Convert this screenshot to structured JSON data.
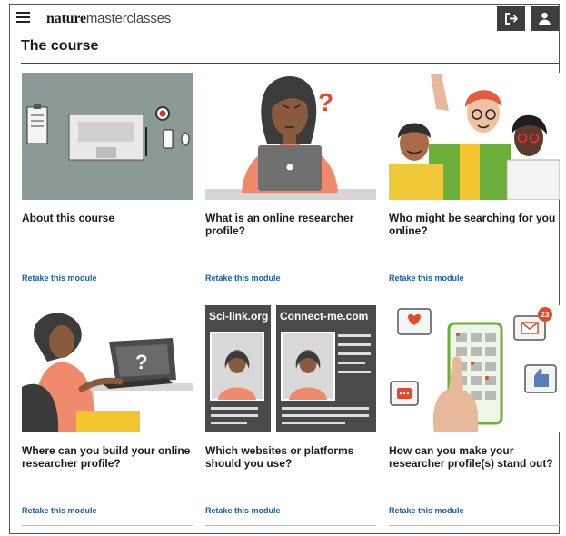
{
  "header": {
    "brand_bold": "nature",
    "brand_light": "masterclasses",
    "menu_icon": "hamburger-icon",
    "logout_icon": "logout-icon",
    "profile_icon": "user-icon"
  },
  "page": {
    "title": "The course"
  },
  "modules": [
    {
      "title": "About this course",
      "action": "Retake this module"
    },
    {
      "title": "What is an online researcher profile?",
      "action": "Retake this module"
    },
    {
      "title": "Who might be searching for you online?",
      "action": "Retake this module"
    },
    {
      "title": "Where can you build your online researcher profile?",
      "action": "Retake this module"
    },
    {
      "title": "Which websites or platforms should you use?",
      "action": "Retake this module"
    },
    {
      "title": "How can you make your researcher profile(s) stand out?",
      "action": "Retake this module"
    }
  ],
  "illustration_text": {
    "question_mark": "?",
    "site_a": "Sci-link.org",
    "site_b": "Connect-me.com",
    "notification_count": "23"
  },
  "colors": {
    "accent_link": "#1a5fa4",
    "header_button": "#3d3d3d",
    "question_red": "#e04a2a"
  }
}
